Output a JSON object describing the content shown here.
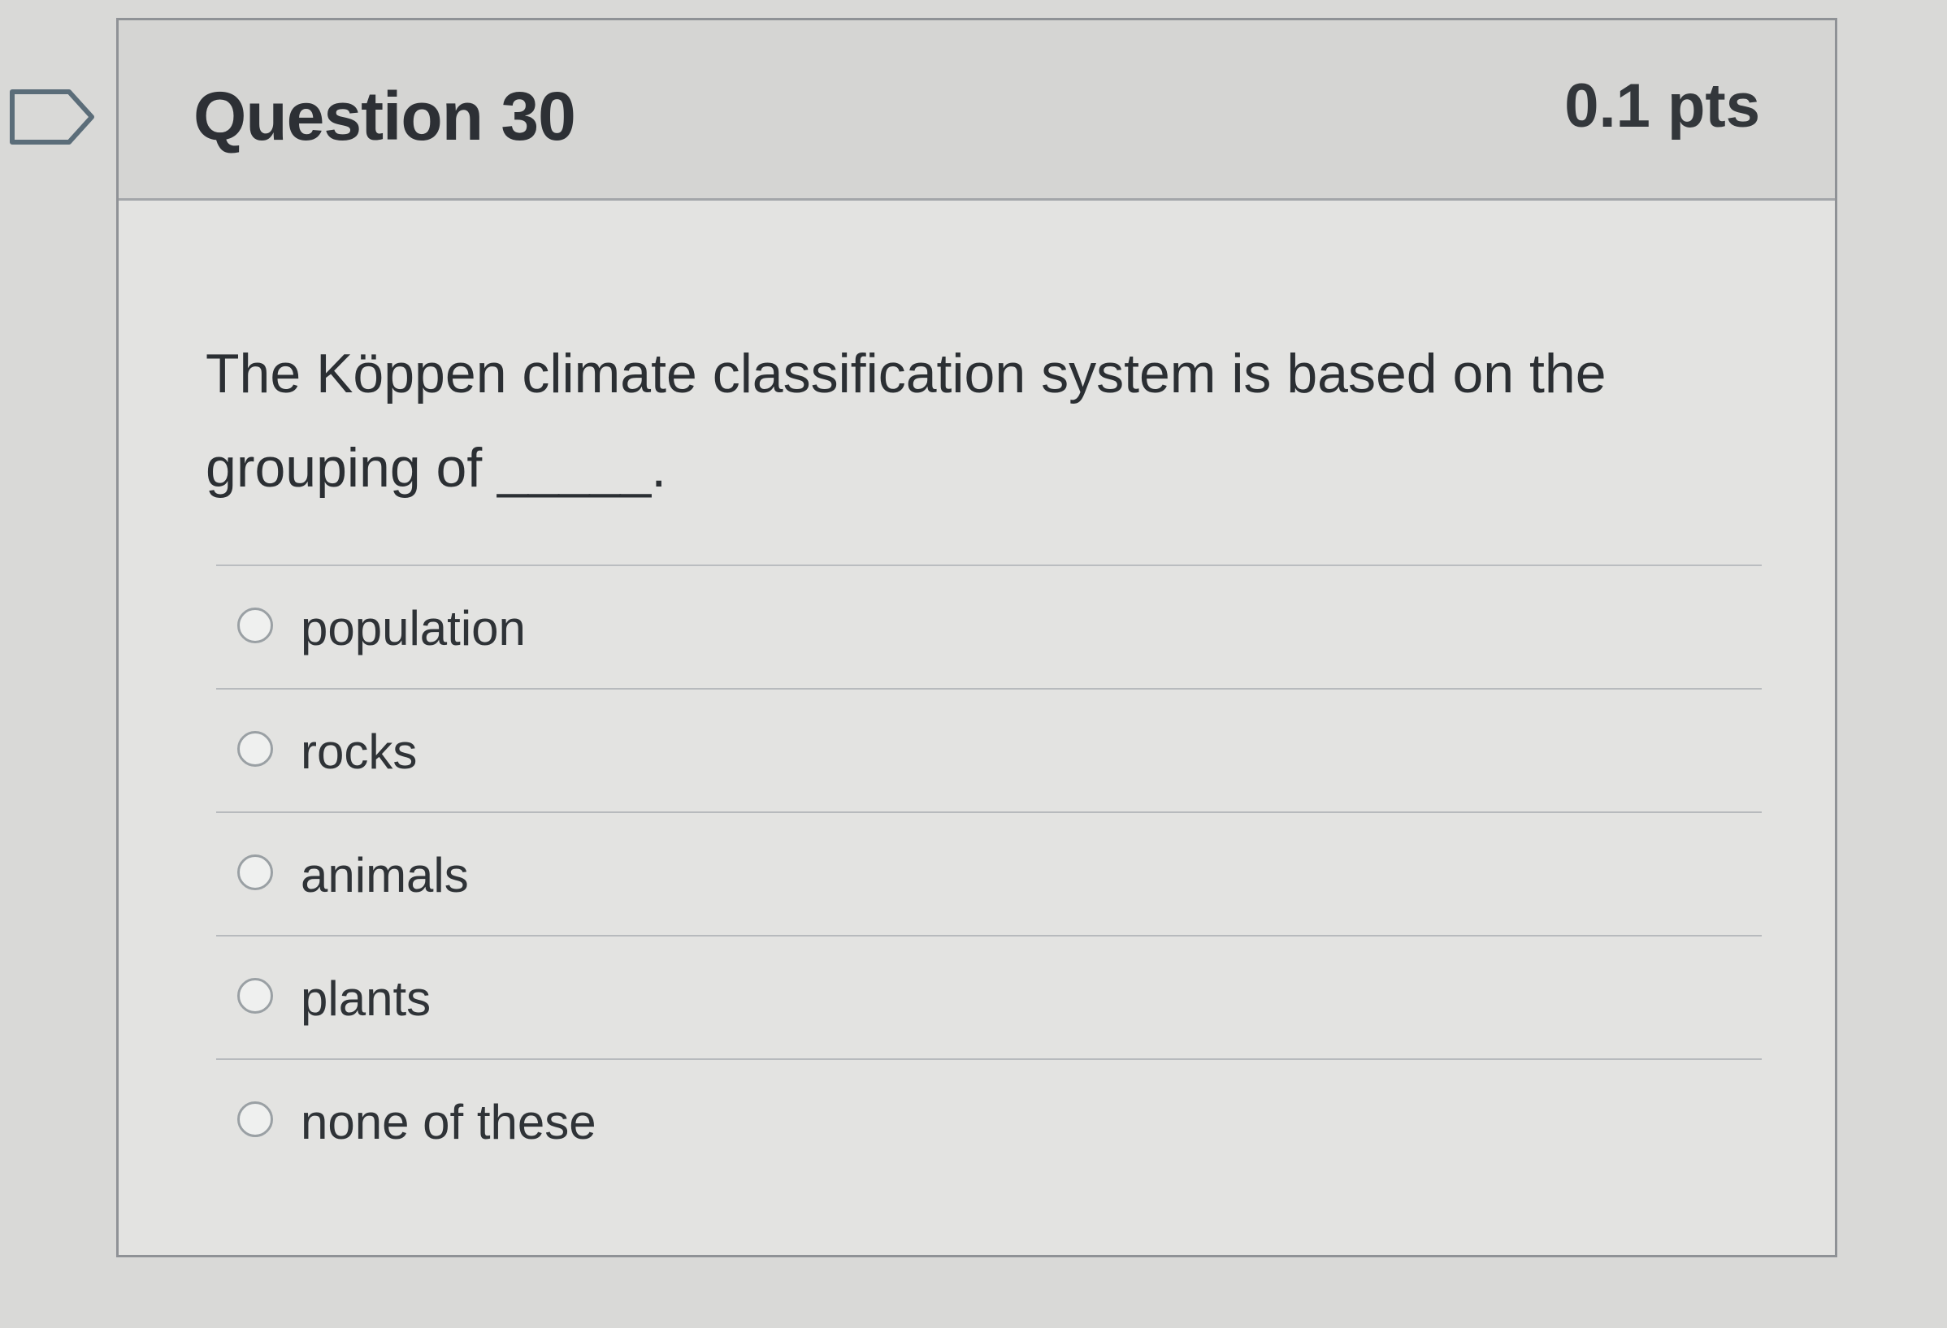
{
  "question": {
    "title": "Question 30",
    "points": "0.1 pts",
    "text": "The Köppen climate classification system is based on the grouping of _____.",
    "flag_icon": "flag-outline-icon"
  },
  "answers": [
    {
      "label": "population",
      "selected": false
    },
    {
      "label": "rocks",
      "selected": false
    },
    {
      "label": "animals",
      "selected": false
    },
    {
      "label": "plants",
      "selected": false
    },
    {
      "label": "none of these",
      "selected": false
    }
  ],
  "colors": {
    "background": "#d9d9d7",
    "card": "#e3e3e1",
    "header": "#d5d5d3",
    "border": "#8f9296",
    "text": "#2d3035"
  }
}
